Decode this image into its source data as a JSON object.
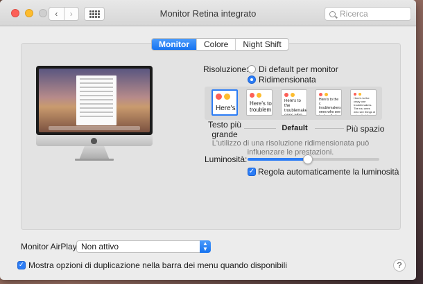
{
  "window": {
    "title": "Monitor Retina integrato",
    "search_placeholder": "Ricerca"
  },
  "tabs": [
    {
      "label": "Monitor",
      "active": true
    },
    {
      "label": "Colore",
      "active": false
    },
    {
      "label": "Night Shift",
      "active": false
    }
  ],
  "resolution": {
    "label": "Risoluzione:",
    "option_default": "Di default per monitor",
    "option_scaled": "Ridimensionata",
    "selected": "Ridimensionata"
  },
  "scale_options": [
    {
      "text": "Here's",
      "selected": true
    },
    {
      "text": "Here's to troublem",
      "selected": false
    },
    {
      "text": "Here's to the troublemakers ones who",
      "selected": false
    },
    {
      "text": "Here's to the c troublemakers. ones who see t rules. And they",
      "selected": false
    },
    {
      "text": "Here's to the crazy one troublemakers. The rou ones who see things di rules. And they have no can quote them, disagree them. About the only thi Because they change th",
      "selected": false
    }
  ],
  "scale_labels": {
    "left": "Testo più grande",
    "middle": "Default",
    "right": "Più spazio"
  },
  "resolution_note": "L'utilizzo di una risoluzione ridimensionata può influenzare le prestazioni.",
  "brightness": {
    "label": "Luminosità:",
    "value": 0.46,
    "auto_label": "Regola automaticamente la luminosità",
    "auto_checked": true
  },
  "airplay": {
    "label": "Monitor AirPlay:",
    "value": "Non attivo"
  },
  "mirroring": {
    "label": "Mostra opzioni di duplicazione nella barra dei menu quando disponibili",
    "checked": true
  },
  "help_label": "?",
  "icons": {
    "back": "‹",
    "forward": "›",
    "select_arrows": "▲▼",
    "check": "✓"
  },
  "colors": {
    "accent": "#2b7cf5",
    "close": "#fc5f57",
    "minimize": "#fdbc2e"
  }
}
